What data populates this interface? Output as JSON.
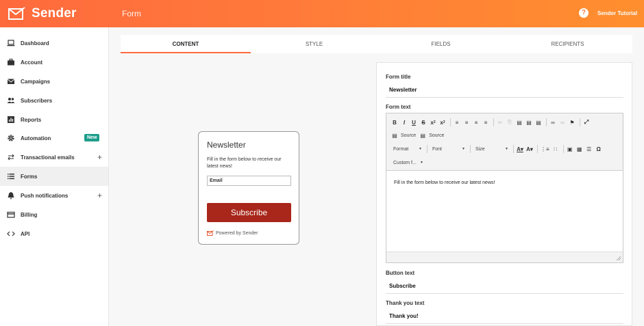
{
  "header": {
    "app_name": "Sender",
    "page_title": "Form",
    "help_icon": "?",
    "user_name": "Sender Tutorial"
  },
  "sidebar": {
    "items": [
      {
        "label": "Dashboard",
        "icon": "laptop-icon"
      },
      {
        "label": "Account",
        "icon": "briefcase-icon"
      },
      {
        "label": "Campaigns",
        "icon": "envelope-icon"
      },
      {
        "label": "Subscribers",
        "icon": "people-icon"
      },
      {
        "label": "Reports",
        "icon": "chart-icon"
      },
      {
        "label": "Automation",
        "icon": "gear-icon",
        "badge": "New"
      },
      {
        "label": "Transactional emails",
        "icon": "swap-icon",
        "expand": "+"
      },
      {
        "label": "Forms",
        "icon": "list-icon",
        "active": true
      },
      {
        "label": "Push notifications",
        "icon": "bell-icon",
        "expand": "+"
      },
      {
        "label": "Billing",
        "icon": "credit-card-icon"
      },
      {
        "label": "API",
        "icon": "code-icon"
      }
    ]
  },
  "tabs": [
    {
      "label": "CONTENT",
      "active": true
    },
    {
      "label": "STYLE"
    },
    {
      "label": "FIELDS"
    },
    {
      "label": "RECIPIENTS"
    }
  ],
  "preview": {
    "title": "Newsletter",
    "text": "Fill in the form below to receive our latest news!",
    "email_placeholder": "Email",
    "button": "Subscribe",
    "powered_by": "Powered by Sender"
  },
  "editor_panel": {
    "form_title_label": "Form title",
    "form_title_value": "Newsletter",
    "form_text_label": "Form text",
    "toolbar": {
      "source_1": "Source",
      "source_2": "Source",
      "format": "Format",
      "font": "Font",
      "size": "Size",
      "custom": "Custom f..."
    },
    "content": "Fill in the form below to receive our latest news!",
    "button_text_label": "Button text",
    "button_text_value": "Subscribe",
    "thank_you_label": "Thank you text",
    "thank_you_value": "Thank you!"
  },
  "colors": {
    "brand_orange": "#ff6a3d",
    "badge_green": "#1e9e8c",
    "button_red": "#a8261a"
  }
}
